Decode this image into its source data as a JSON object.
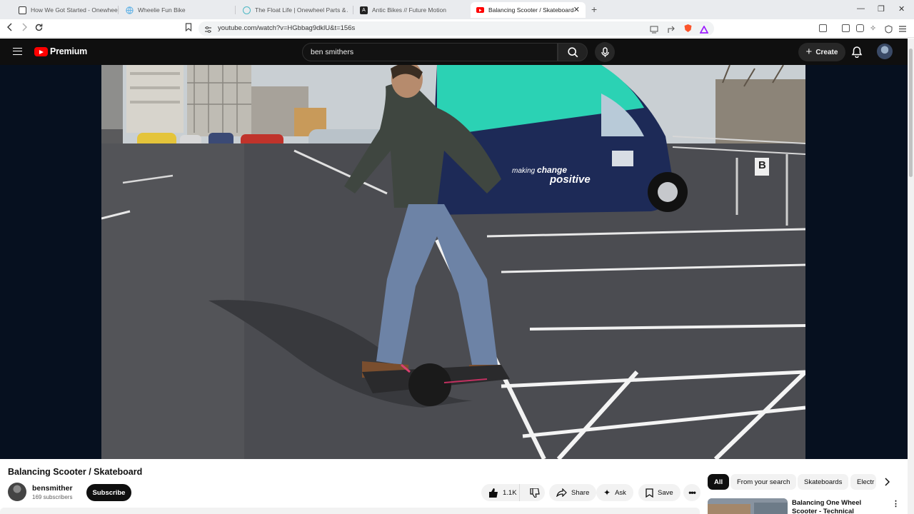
{
  "browser": {
    "tabs": [
      {
        "title": "How We Got Started - Onewheel // P",
        "icon": "onewheel-logo-icon",
        "color": "#333333",
        "active": false
      },
      {
        "title": "Wheelie Fun Bike",
        "icon": "globe-icon",
        "color": "#63b3e6",
        "active": false
      },
      {
        "title": "The Float Life | Onewheel Parts & Acc",
        "icon": "floatlife-icon",
        "color": "#4cb8c4",
        "active": false
      },
      {
        "title": "Antic Bikes // Future Motion",
        "icon": "antic-logo-icon",
        "color": "#222222",
        "active": false
      },
      {
        "title": "Balancing Scooter / Skateboard",
        "icon": "youtube-icon",
        "color": "#ff0000",
        "active": true
      }
    ],
    "new_tab": "+",
    "url": "youtube.com/watch?v=HGbbag9dklU&t=156s"
  },
  "masthead": {
    "brand": "Premium",
    "search_value": "ben smithers",
    "create_label": "Create"
  },
  "video": {
    "title": "Balancing Scooter / Skateboard",
    "van_text_1": "making",
    "van_text_2": "change",
    "van_text_3": "positive",
    "bay_marker": "B"
  },
  "channel": {
    "name": "bensmither",
    "subscribers": "169 subscribers",
    "subscribe_label": "Subscribe"
  },
  "actions": {
    "likes": "1.1K",
    "share": "Share",
    "ask": "Ask",
    "save": "Save"
  },
  "chips": [
    "All",
    "From your search",
    "Skateboards",
    "Electr"
  ],
  "recommendation": {
    "title": "Balancing One Wheel Scooter - Technical Overview"
  },
  "colors": {
    "youtube_red": "#ff0000",
    "masthead_bg": "#0f0f0f",
    "player_bg": "#06101f",
    "van_teal": "#2bd2b4",
    "van_navy": "#1d2a57"
  }
}
